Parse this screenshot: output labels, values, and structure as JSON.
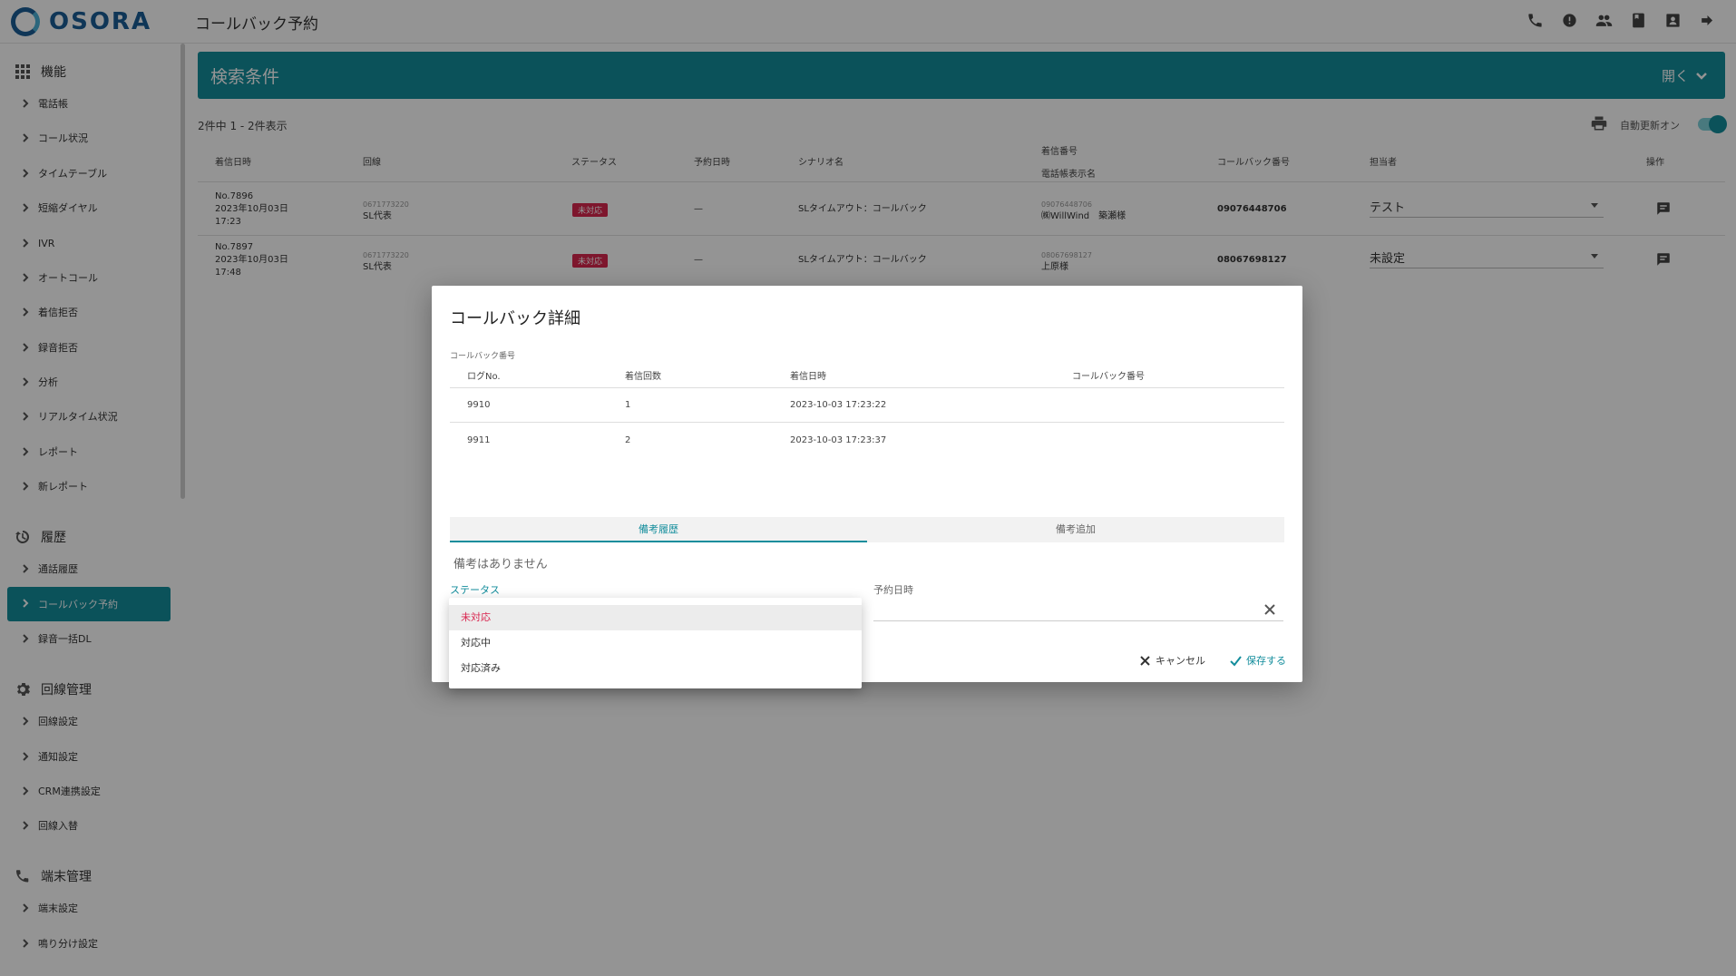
{
  "app": {
    "logo_text": "OSORA",
    "page_title": "コールバック予約"
  },
  "top_icons": [
    "phone-icon",
    "badge-icon",
    "people-icon",
    "book-icon",
    "contact-icon",
    "logout-icon"
  ],
  "sidebar": {
    "sections": [
      {
        "label": "機能",
        "icon": "grid-icon"
      },
      {
        "label": "履歴",
        "icon": "history-icon"
      },
      {
        "label": "回線管理",
        "icon": "gear-icon"
      },
      {
        "label": "端末管理",
        "icon": "phone-icon"
      }
    ],
    "items": [
      "電話帳",
      "コール状況",
      "タイムテーブル",
      "短縮ダイヤル",
      "IVR",
      "オートコール",
      "着信拒否",
      "録音拒否",
      "分析",
      "リアルタイム状況",
      "レポート",
      "新レポート",
      "通話履歴",
      "コールバック予約",
      "録音一括DL",
      "回線設定",
      "通知設定",
      "CRM連携設定",
      "回線入替",
      "端末設定",
      "鳴り分け設定"
    ],
    "active_item": "コールバック予約"
  },
  "search": {
    "title": "検索条件",
    "toggle_label": "開く"
  },
  "list": {
    "count_text": "2件中 1 - 2件表示",
    "auto_refresh_label": "自動更新オン",
    "auto_refresh_on": true,
    "headers": {
      "received_at": "着信日時",
      "line": "回線",
      "status": "ステータス",
      "reserved_at": "予約日時",
      "scenario": "シナリオ名",
      "caller_number": "着信番号",
      "caller_name": "電話帳表示名",
      "callback_number": "コールバック番号",
      "assignee": "担当者",
      "actions": "操作"
    },
    "rows": [
      {
        "no": "No.7896",
        "date": "2023年10月03日",
        "time": "17:23",
        "line_number": "0671773220",
        "line_name": "SL代表",
        "status": "未対応",
        "reserved": "—",
        "scenario": "SLタイムアウト：コールバック",
        "caller_number": "09076448706",
        "caller_name": "㈱WillWind　築瀬様",
        "callback_number": "09076448706",
        "assignee": "テスト"
      },
      {
        "no": "No.7897",
        "date": "2023年10月03日",
        "time": "17:48",
        "line_number": "0671773220",
        "line_name": "SL代表",
        "status": "未対応",
        "reserved": "—",
        "scenario": "SLタイムアウト：コールバック",
        "caller_number": "08067698127",
        "caller_name": "上原様",
        "callback_number": "08067698127",
        "assignee": "未設定"
      }
    ]
  },
  "modal": {
    "title": "コールバック詳細",
    "caption": "コールバック番号",
    "headers": {
      "log_no": "ログNo.",
      "count": "着信回数",
      "received_at": "着信日時",
      "callback_number": "コールバック番号"
    },
    "rows": [
      {
        "log_no": "9910",
        "count": "1",
        "received_at": "2023-10-03 17:23:22"
      },
      {
        "log_no": "9911",
        "count": "2",
        "received_at": "2023-10-03 17:23:37"
      }
    ],
    "tabs": [
      "備考履歴",
      "備考追加"
    ],
    "no_memo": "備考はありません",
    "status_label": "ステータス",
    "date_label": "予約日時",
    "cancel_label": "キャンセル",
    "save_label": "保存する"
  },
  "dropdown": {
    "options": [
      "未対応",
      "対応中",
      "対応済み"
    ],
    "selected": "未対応"
  },
  "colors": {
    "accent": "#138d9c",
    "alert": "#d9264f",
    "brand": "#1a5e96"
  }
}
